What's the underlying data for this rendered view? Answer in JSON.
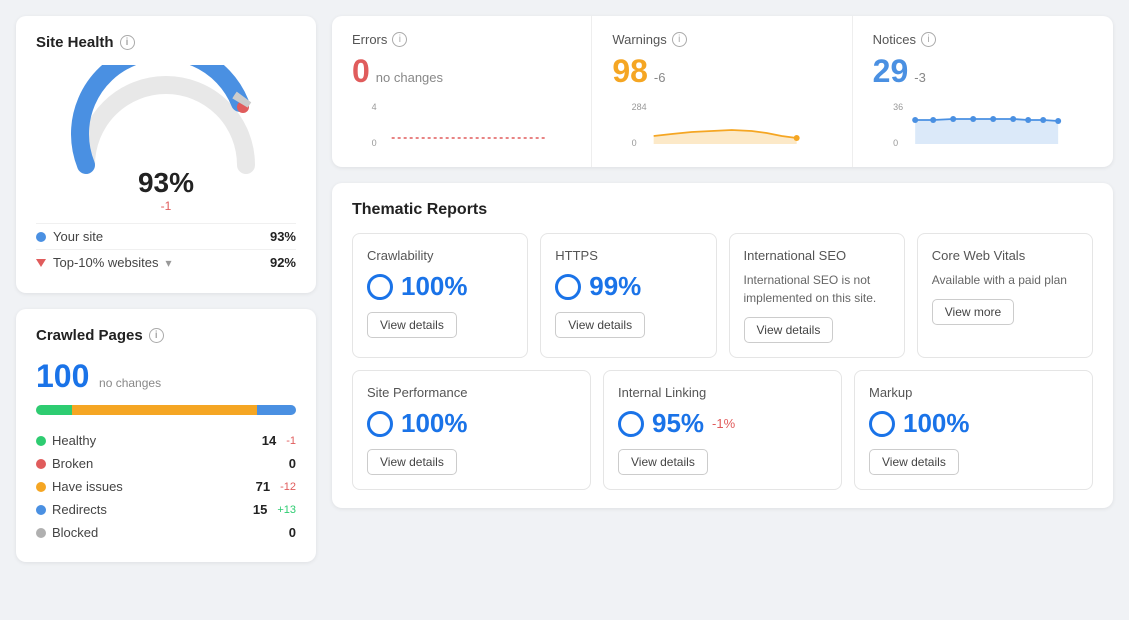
{
  "left": {
    "siteHealth": {
      "title": "Site Health",
      "percentage": "93%",
      "delta": "-1",
      "yourSite": {
        "label": "Your site",
        "value": "93%"
      },
      "top10": {
        "label": "Top-10% websites",
        "value": "92%"
      }
    },
    "crawledPages": {
      "title": "Crawled Pages",
      "count": "100",
      "noChanges": "no changes",
      "stats": [
        {
          "label": "Healthy",
          "color": "#2ecc71",
          "value": "14",
          "delta": "-1",
          "deltaType": "neg"
        },
        {
          "label": "Broken",
          "color": "#e05c5c",
          "value": "0",
          "delta": "",
          "deltaType": ""
        },
        {
          "label": "Have issues",
          "color": "#f5a623",
          "value": "71",
          "delta": "-12",
          "deltaType": "neg"
        },
        {
          "label": "Redirects",
          "color": "#4a90e2",
          "value": "15",
          "delta": "+13",
          "deltaType": "pos"
        },
        {
          "label": "Blocked",
          "color": "#b0b0b0",
          "value": "0",
          "delta": "",
          "deltaType": ""
        }
      ]
    }
  },
  "metrics": [
    {
      "label": "Errors",
      "value": "0",
      "delta": "no changes",
      "colorClass": "metric-zero",
      "chartColor": "#e05c5c",
      "yMax": "4",
      "yMin": "0"
    },
    {
      "label": "Warnings",
      "value": "98",
      "delta": "-6",
      "colorClass": "metric-warn",
      "chartColor": "#f5a623",
      "yMax": "284",
      "yMin": "0"
    },
    {
      "label": "Notices",
      "value": "29",
      "delta": "-3",
      "colorClass": "metric-notice",
      "chartColor": "#4a90e2",
      "yMax": "36",
      "yMin": "0"
    }
  ],
  "thematic": {
    "title": "Thematic Reports",
    "row1": [
      {
        "name": "Crawlability",
        "pct": "100%",
        "delta": "",
        "hasCircle": true,
        "btnLabel": "View details",
        "desc": ""
      },
      {
        "name": "HTTPS",
        "pct": "99%",
        "delta": "",
        "hasCircle": true,
        "btnLabel": "View details",
        "desc": ""
      },
      {
        "name": "International SEO",
        "pct": "",
        "delta": "",
        "hasCircle": false,
        "btnLabel": "View details",
        "desc": "International SEO is not implemented on this site."
      },
      {
        "name": "Core Web Vitals",
        "pct": "",
        "delta": "",
        "hasCircle": false,
        "btnLabel": "View more",
        "desc": "Available with a paid plan"
      }
    ],
    "row2": [
      {
        "name": "Site Performance",
        "pct": "100%",
        "delta": "",
        "hasCircle": true,
        "btnLabel": "View details",
        "desc": ""
      },
      {
        "name": "Internal Linking",
        "pct": "95%",
        "delta": "-1%",
        "hasCircle": true,
        "btnLabel": "View details",
        "desc": ""
      },
      {
        "name": "Markup",
        "pct": "100%",
        "delta": "",
        "hasCircle": true,
        "btnLabel": "View details",
        "desc": ""
      }
    ]
  }
}
